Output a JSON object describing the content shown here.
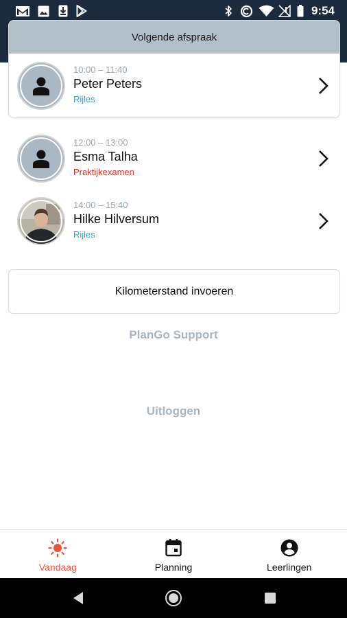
{
  "status_bar": {
    "time": "9:54",
    "icons": [
      "gmail-icon",
      "image-icon",
      "download-icon",
      "play-store-icon",
      "bluetooth-icon",
      "data-saver-icon",
      "wifi-icon",
      "no-signal-icon",
      "battery-icon"
    ]
  },
  "next_appointment": {
    "header": "Volgende afspraak",
    "time": "10:00 – 11:40",
    "name": "Peter Peters",
    "type": "Rijles"
  },
  "appointments": [
    {
      "time": "12:00 – 13:00",
      "name": "Esma Talha",
      "type": "Praktijkexamen"
    },
    {
      "time": "14:00 – 15:40",
      "name": "Hilke Hilversum",
      "type": "Rijles"
    }
  ],
  "km_button_label": "Kilometerstand invoeren",
  "support_link": "PlanGo Support",
  "logout_link": "Uitloggen",
  "bottom_nav": {
    "items": [
      {
        "label": "Vandaag",
        "icon": "sun-icon",
        "active": true
      },
      {
        "label": "Planning",
        "icon": "calendar-icon",
        "active": false
      },
      {
        "label": "Leerlingen",
        "icon": "account-circle-icon",
        "active": false
      }
    ]
  },
  "colors": {
    "header_bg": "#1b2a3d",
    "card_header_bg": "#b2c0ca",
    "accent_active": "#e8533d",
    "type_blue": "#3ea0d6",
    "type_red": "#d6362a",
    "muted_link": "#a9b6c0"
  }
}
